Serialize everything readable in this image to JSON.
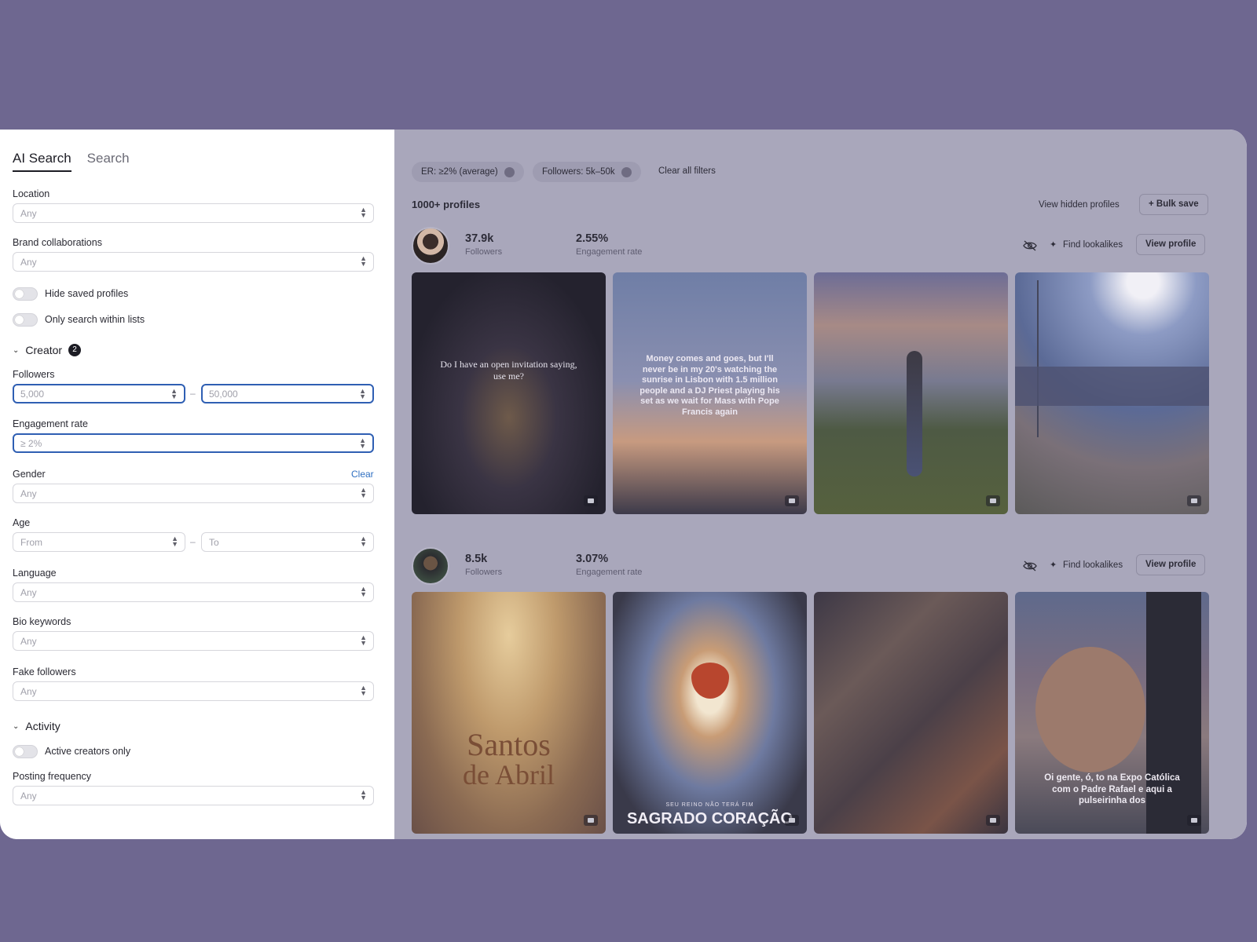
{
  "tabs": [
    "AI Search",
    "Search"
  ],
  "filters": {
    "location": {
      "label": "Location",
      "value": "Any"
    },
    "brand": {
      "label": "Brand collaborations",
      "value": "Any"
    },
    "hide_saved": "Hide saved profiles",
    "only_lists": "Only search within lists",
    "creator": {
      "title": "Creator",
      "badge": "2"
    },
    "followers": {
      "label": "Followers",
      "from": "5,000",
      "to": "50,000",
      "dash": "–"
    },
    "engagement": {
      "label": "Engagement rate",
      "value": "≥ 2%"
    },
    "gender": {
      "label": "Gender",
      "value": "Any",
      "clear": "Clear"
    },
    "age": {
      "label": "Age",
      "from": "From",
      "to": "To",
      "dash": "–"
    },
    "language": {
      "label": "Language",
      "value": "Any"
    },
    "bio": {
      "label": "Bio keywords",
      "value": "Any"
    },
    "fake": {
      "label": "Fake followers",
      "value": "Any"
    },
    "activity": {
      "title": "Activity"
    },
    "active_only": "Active creators only",
    "posting": {
      "label": "Posting frequency",
      "value": "Any"
    }
  },
  "main": {
    "chips": [
      "ER: ≥2% (average)",
      "Followers: 5k–50k"
    ],
    "clear_all": "Clear all filters",
    "count": "1000+ profiles",
    "view_hidden": "View hidden profiles",
    "bulk_save": "+ Bulk save",
    "find_lookalikes": "Find lookalikes",
    "view_profile": "View profile",
    "profiles": [
      {
        "followers": "37.9k",
        "followers_label": "Followers",
        "er": "2.55%",
        "er_label": "Engagement rate"
      },
      {
        "followers": "8.5k",
        "followers_label": "Followers",
        "er": "3.07%",
        "er_label": "Engagement rate"
      }
    ],
    "tile_texts": {
      "t1": "Do I have an open invitation saying, use me?",
      "t2": "Money comes and goes, but I'll never be in my 20's watching the sunrise in Lisbon with 1.5 million people and a DJ Priest playing his set as we wait for Mass with Pope Francis again",
      "t5a": "Santos",
      "t5b": "de Abril",
      "t6a": "SEU REINO NÃO TERÁ FIM",
      "t6b": "SAGRADO CORAÇÃO",
      "t8": "Oi gente, ó, to na Expo Católica com o Padre Rafael e aqui a pulseirinha dos"
    }
  }
}
